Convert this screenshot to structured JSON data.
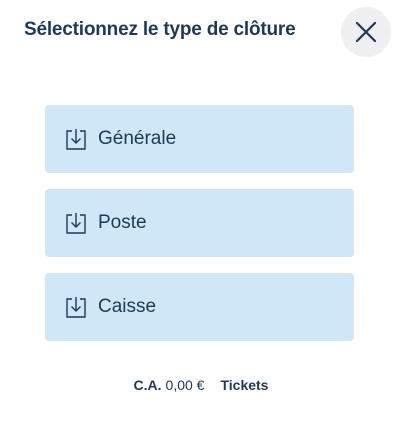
{
  "dialog": {
    "title": "Sélectionnez le type de clôture",
    "close_icon": "close-icon"
  },
  "options": [
    {
      "label": "Générale",
      "icon": "download-icon"
    },
    {
      "label": "Poste",
      "icon": "download-icon"
    },
    {
      "label": "Caisse",
      "icon": "download-icon"
    }
  ],
  "footer": {
    "ca_label": "C.A.",
    "ca_value": "0,00 €",
    "tickets_label": "Tickets"
  },
  "colors": {
    "text": "#1d3a57",
    "option_background": "#cfe7f6",
    "close_background": "#eef0f2"
  }
}
